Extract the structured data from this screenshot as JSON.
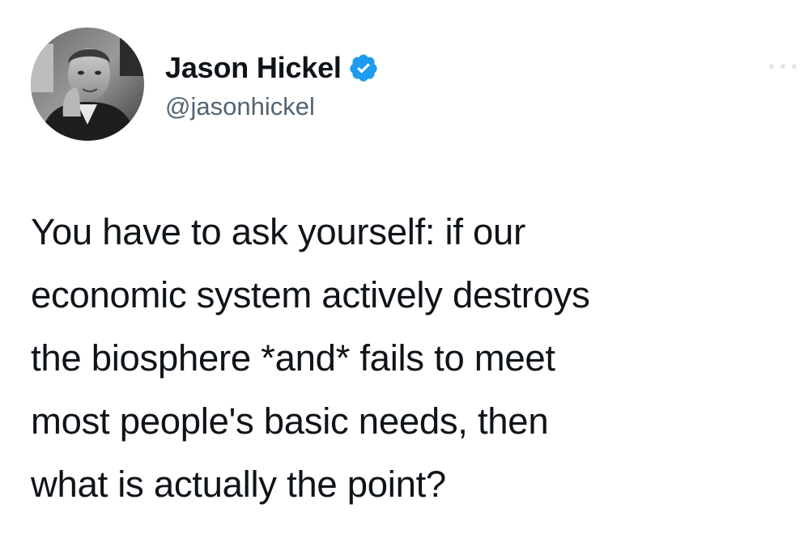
{
  "author": {
    "display_name": "Jason Hickel",
    "handle": "@jasonhickel",
    "verified": true,
    "avatar_icon": "profile-photo",
    "badge_color": "#1d9bf0"
  },
  "tweet": {
    "text": "You have to ask yourself: if our\neconomic system actively destroys\nthe biosphere *and* fails to meet\nmost people's basic needs, then\nwhat is actually the point?"
  },
  "colors": {
    "text_primary": "#0f1419",
    "text_secondary": "#536471",
    "background": "#ffffff"
  }
}
